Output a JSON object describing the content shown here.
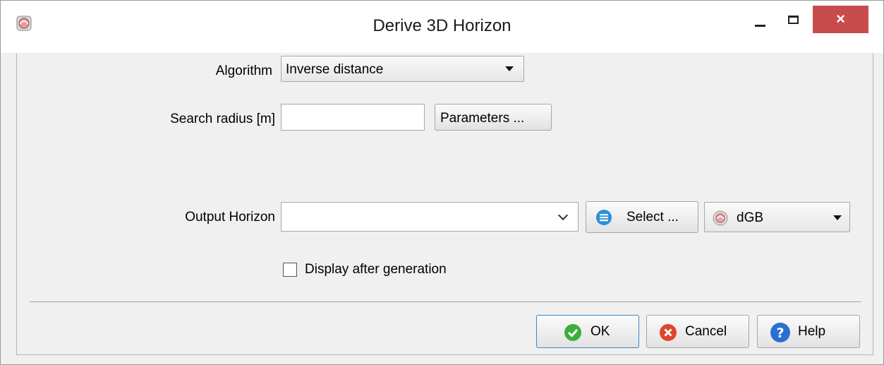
{
  "window": {
    "title": "Derive 3D Horizon",
    "app_icon": "opendtect-logo-icon",
    "controls": {
      "minimize": "minimize-icon",
      "maximize": "maximize-icon",
      "close": "×"
    }
  },
  "form": {
    "algorithm": {
      "label": "Algorithm",
      "value": "Inverse distance"
    },
    "search_radius": {
      "label": "Search radius [m]",
      "value": "",
      "parameters_button": "Parameters ..."
    },
    "output_horizon": {
      "label": "Output Horizon",
      "value": "",
      "select_button": "Select ...",
      "select_icon": "list-circle-icon",
      "storage": {
        "value": "dGB",
        "icon": "dgb-logo-icon"
      }
    },
    "display_after_generation": {
      "label": "Display after generation",
      "checked": false
    }
  },
  "buttons": {
    "ok": {
      "label": "OK",
      "icon": "check-icon",
      "color": "#3cae3c"
    },
    "cancel": {
      "label": "Cancel",
      "icon": "cancel-icon",
      "color": "#e0452f"
    },
    "help": {
      "label": "Help",
      "icon": "help-icon",
      "color": "#2a6fd1"
    }
  },
  "colors": {
    "close_button": "#c94c4c",
    "background": "#f0f0f0"
  }
}
